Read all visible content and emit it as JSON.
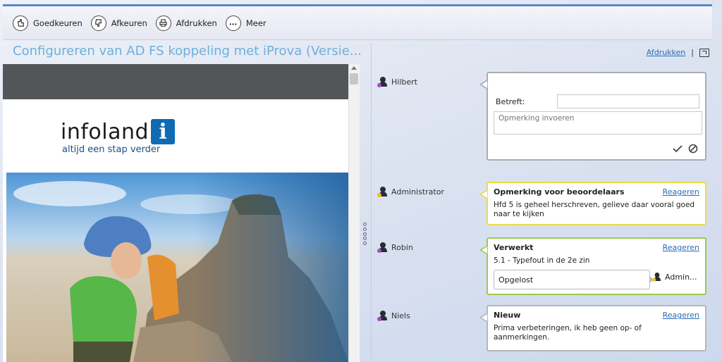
{
  "toolbar": {
    "buttons": [
      {
        "label": "Goedkeuren",
        "icon": "approve-icon"
      },
      {
        "label": "Afkeuren",
        "icon": "reject-icon"
      },
      {
        "label": "Afdrukken",
        "icon": "printer-icon"
      },
      {
        "label": "Meer",
        "icon": "more-icon"
      }
    ]
  },
  "document": {
    "title": "Configureren van AD FS koppeling met iProva (Versie...",
    "logo_word": "infoland",
    "logo_badge": "i",
    "logo_tagline": "altijd een stap verder"
  },
  "right_pane": {
    "print_link": "Afdrukken",
    "separator": "|"
  },
  "new_comment": {
    "author": "Hilbert",
    "subject_label": "Betreft:",
    "subject_value": "",
    "remark_placeholder": "Opmerking invoeren"
  },
  "comments": [
    {
      "author": "Administrator",
      "title": "Opmerking voor beoordelaars",
      "reply_label": "Reageren",
      "text": "Hfd 5 is geheel herschreven, gelieve daar vooral goed naar te kijken",
      "border_color": "#e8dd45"
    },
    {
      "author": "Robin",
      "title": "Verwerkt",
      "reply_label": "Reageren",
      "text": "5.1 - Typefout in de 2e zin",
      "status": "Opgelost",
      "resolved_by": "Admin...",
      "border_color": "#9bcb4f"
    },
    {
      "author": "Niels",
      "title": "Nieuw",
      "reply_label": "Reageren",
      "text": "Prima verbeteringen, ik heb geen op- of aanmerkingen.",
      "border_color": "#b3b6bc"
    }
  ],
  "colors": {
    "accent_blue": "#2a6db4",
    "title_blue": "#6db0dc",
    "logo_blue": "#0f6bb3"
  }
}
